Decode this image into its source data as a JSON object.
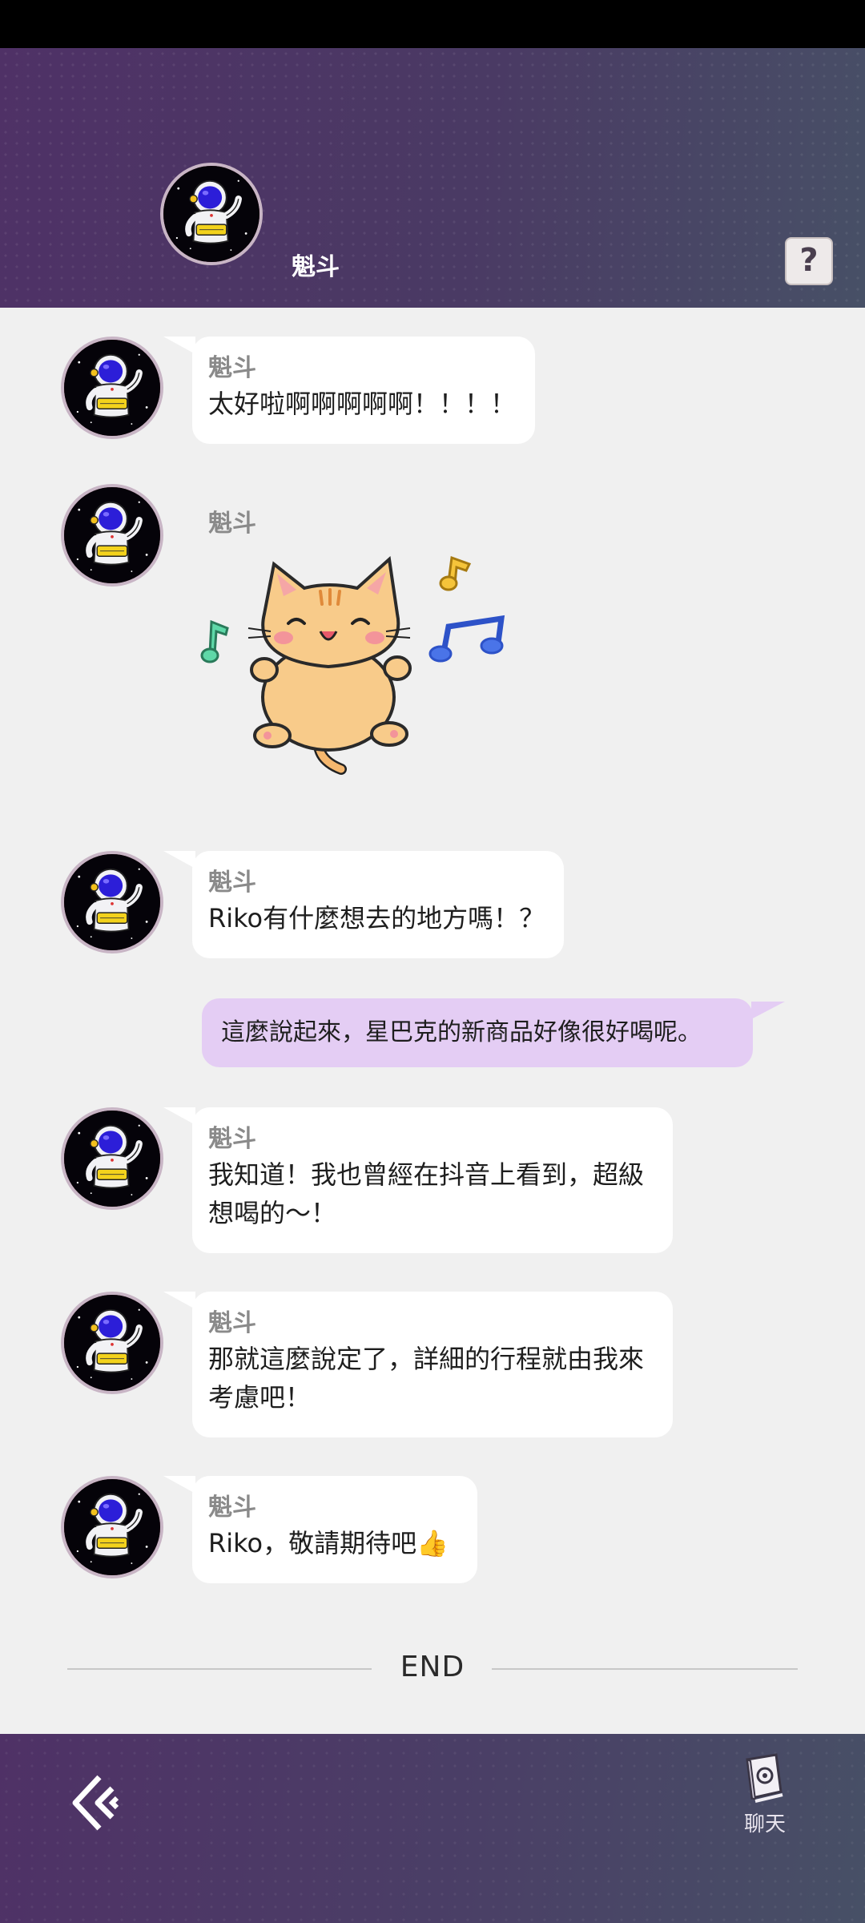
{
  "header": {
    "contact_name": "魁斗",
    "help_label": "?"
  },
  "messages": [
    {
      "sender": "魁斗",
      "text": "太好啦啊啊啊啊啊！！！！"
    },
    {
      "sender": "魁斗",
      "sticker": "dancing-cat-sticker"
    },
    {
      "sender": "魁斗",
      "text": "Riko有什麼想去的地方嗎！？"
    },
    {
      "sender": "me",
      "text": "這麼說起來，星巴克的新商品好像很好喝呢。"
    },
    {
      "sender": "魁斗",
      "line1": "我知道！我也曾經在抖音上看到，超級",
      "line2": "想喝的～！"
    },
    {
      "sender": "魁斗",
      "line1": "那就這麼說定了，詳細的行程就由我來",
      "line2": "考慮吧！"
    },
    {
      "sender": "魁斗",
      "text": "Riko，敬請期待吧👍"
    }
  ],
  "end_label": "END",
  "footer": {
    "chat_label": "聊天"
  },
  "colors": {
    "header": "#4f3166",
    "my_bubble": "#e4cdf4",
    "their_bubble": "#ffffff",
    "background": "#f0f0f0"
  },
  "icons": [
    "astronaut-avatar-icon",
    "help-icon",
    "back-icon",
    "chat-book-icon"
  ]
}
